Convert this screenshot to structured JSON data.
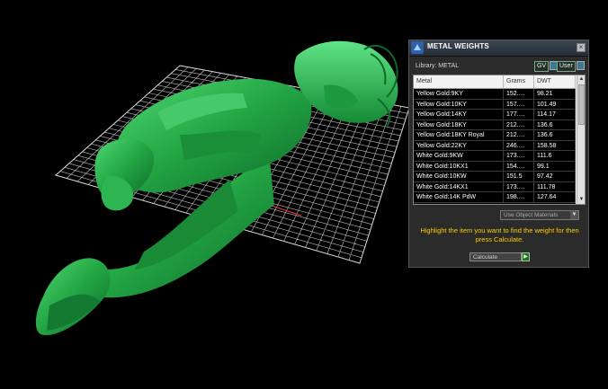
{
  "panel": {
    "title": "METAL WEIGHTS",
    "close_glyph": "×",
    "library": "Library: METAL",
    "gv_label": "GV",
    "user_label": "User",
    "columns": [
      "Metal",
      "Grams",
      "DWT"
    ],
    "rows": [
      {
        "metal": "Yellow Gold:9KY",
        "grams": "152.…",
        "dwt": "98.21"
      },
      {
        "metal": "Yellow Gold:10KY",
        "grams": "157.…",
        "dwt": "101.49"
      },
      {
        "metal": "Yellow Gold:14KY",
        "grams": "177.…",
        "dwt": "114.17"
      },
      {
        "metal": "Yellow Gold:18KY",
        "grams": "212.…",
        "dwt": "136.6"
      },
      {
        "metal": "Yellow Gold:18KY Royal",
        "grams": "212.…",
        "dwt": "136.6"
      },
      {
        "metal": "Yellow Gold:22KY",
        "grams": "246.…",
        "dwt": "158.58"
      },
      {
        "metal": "White Gold:9KW",
        "grams": "173.…",
        "dwt": "111.6"
      },
      {
        "metal": "White Gold:10KX1",
        "grams": "154.…",
        "dwt": "99.1"
      },
      {
        "metal": "White Gold:10KW",
        "grams": "151.5",
        "dwt": "97.42"
      },
      {
        "metal": "White Gold:14KX1",
        "grams": "173.…",
        "dwt": "111.78"
      },
      {
        "metal": "White Gold:14K PdW",
        "grams": "198.…",
        "dwt": "127.64"
      }
    ],
    "select_value": "Use Object Materials",
    "hint": "Highlight the item you want to find the weight for then press Calculate.",
    "calculate_label": "Calculate"
  },
  "colors": {
    "model": "#1fa23c",
    "hint": "#ffcc00",
    "grid": "#cfcfcf",
    "axis": "#ff3333"
  }
}
